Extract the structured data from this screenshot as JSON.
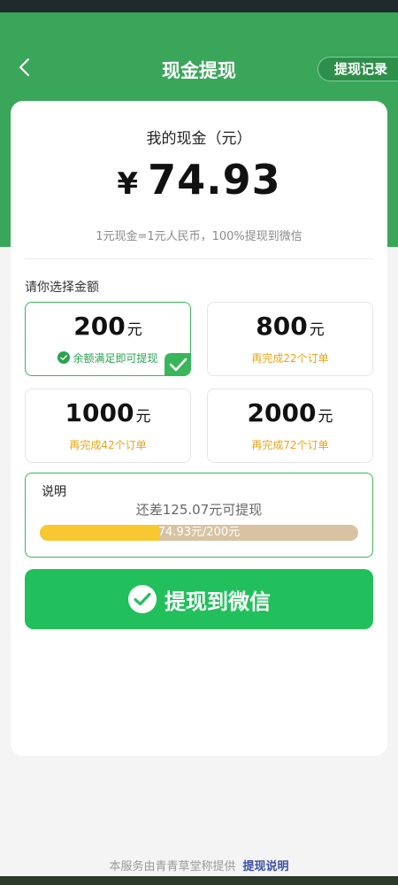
{
  "colors": {
    "brand_green": "#3aa65a",
    "button_green": "#21c05c",
    "accent_orange": "#e9a415",
    "progress_yellow": "#f7c830"
  },
  "header": {
    "title": "现金提现",
    "records_label": "提现记录",
    "back_icon": "chevron-left-icon"
  },
  "cash": {
    "label": "我的现金（元）",
    "currency": "¥",
    "amount": "74.93",
    "rate_note": "1元现金=1元人民币，100%提现到微信"
  },
  "choose": {
    "label": "请你选择金额",
    "options": [
      {
        "amount": "200",
        "unit": "元",
        "note": "余额满足即可提现",
        "selected": true
      },
      {
        "amount": "800",
        "unit": "元",
        "note": "再完成22个订单",
        "selected": false
      },
      {
        "amount": "1000",
        "unit": "元",
        "note": "再完成42个订单",
        "selected": false
      },
      {
        "amount": "2000",
        "unit": "元",
        "note": "再完成72个订单",
        "selected": false
      }
    ]
  },
  "explain": {
    "title": "说明",
    "need_text": "还差125.07元可提现",
    "progress_text": "74.93元/200元",
    "progress_fraction": 0.3747
  },
  "withdraw_button": {
    "label": "提现到微信",
    "icon": "wechat-icon"
  },
  "footer": {
    "provider_text": "本服务由青青草堂称提供",
    "help_link": "提现说明"
  }
}
